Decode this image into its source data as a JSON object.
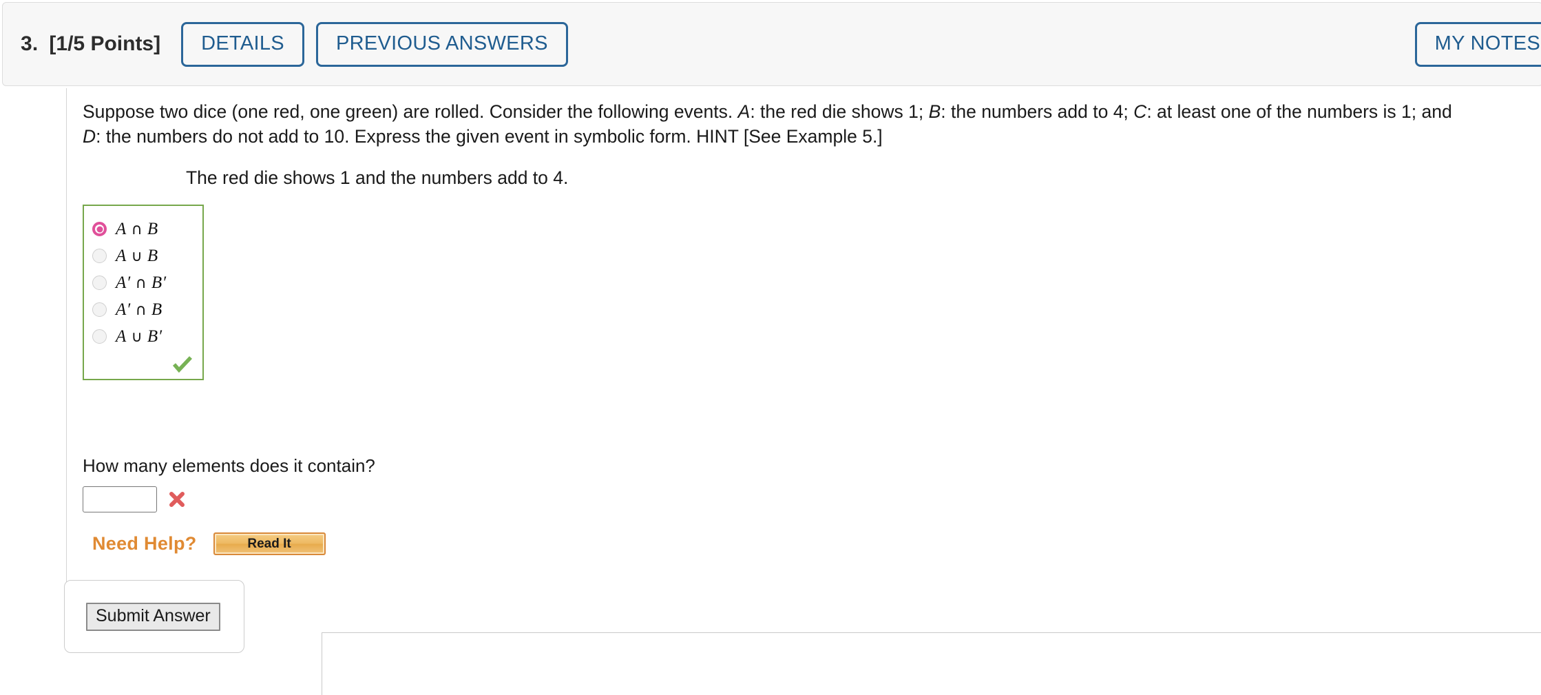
{
  "header": {
    "question_number": "3.",
    "points": "[1/5 Points]",
    "details_label": "DETAILS",
    "previous_answers_label": "PREVIOUS ANSWERS",
    "my_notes_label": "MY NOTES",
    "accent_color": "#2b6699"
  },
  "problem": {
    "prompt_part1": "Suppose two dice (one red, one green) are rolled. Consider the following events. ",
    "var_a": "A",
    "prompt_part2": ": the red die shows 1; ",
    "var_b": "B",
    "prompt_part3": ": the numbers add to 4; ",
    "var_c": "C",
    "prompt_part4": ": at least one of the numbers is 1; and ",
    "var_d": "D",
    "prompt_part5": ": the numbers do not add to 10. Express the given event in symbolic form. HINT [See Example 5.]",
    "sub_prompt": "The red die shows 1 and the numbers add to 4."
  },
  "choices": {
    "correct_color": "#76a74b",
    "selected_color": "#e0509a",
    "options": [
      {
        "set1": "A",
        "operator": "∩",
        "set2": "B",
        "selected": true
      },
      {
        "set1": "A",
        "operator": "∪",
        "set2": "B",
        "selected": false
      },
      {
        "set1": "A′",
        "operator": "∩",
        "set2": "B′",
        "selected": false
      },
      {
        "set1": "A′",
        "operator": "∩",
        "set2": "B",
        "selected": false
      },
      {
        "set1": "A",
        "operator": "∪",
        "set2": "B′",
        "selected": false
      }
    ],
    "status_icon": "green-check-icon"
  },
  "elements_question": {
    "label": "How many elements does it contain?",
    "input_value": "",
    "input_placeholder": "",
    "status_icon": "red-x-icon",
    "status_color": "#e05c5c"
  },
  "need_help": {
    "label": "Need Help?",
    "label_color": "#e08a33",
    "read_it_label": "Read It"
  },
  "footer": {
    "submit_label": "Submit Answer"
  }
}
